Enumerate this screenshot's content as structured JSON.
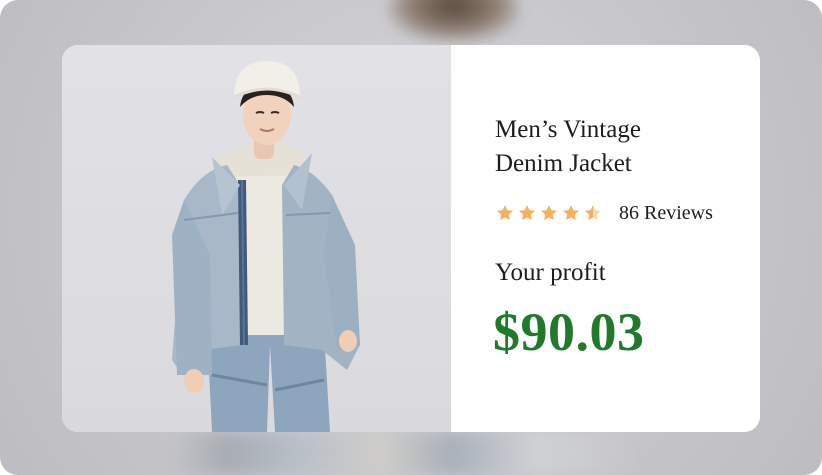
{
  "product": {
    "title_line1": "Men’s Vintage",
    "title_line2": "Denim Jacket",
    "rating": 4.5,
    "rating_max": 5,
    "reviews_label": "86 Reviews",
    "profit_label": "Your profit",
    "profit_value": "$90.03",
    "image_icon": "product-photo-denim-jacket"
  },
  "colors": {
    "star": "#f6b15c",
    "profit": "#1f7a2a",
    "text": "#1d1d1d"
  }
}
